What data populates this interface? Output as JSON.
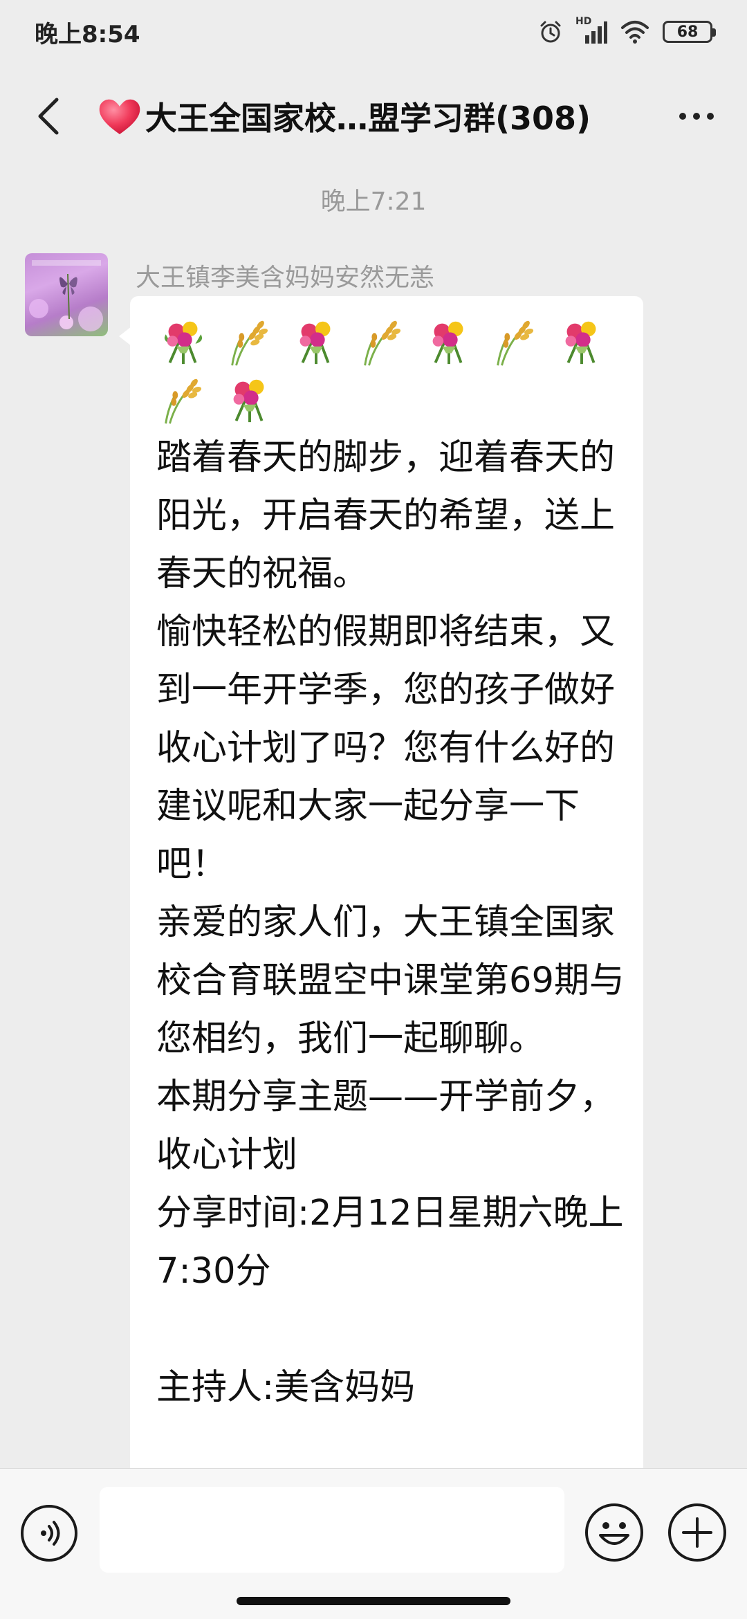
{
  "status_bar": {
    "time": "晚上8:54",
    "network_label": "HD",
    "battery": "68"
  },
  "header": {
    "title": "大王全国家校…盟学习群(308)",
    "heart_icon": "red-heart-emoji"
  },
  "chat": {
    "time_divider": "晚上7:21",
    "message": {
      "sender": "大王镇李美含妈妈安然无恙",
      "emoji_sequence": [
        "bouquet",
        "rice-ear",
        "bouquet",
        "rice-ear",
        "bouquet",
        "rice-ear",
        "bouquet",
        "rice-ear",
        "bouquet"
      ],
      "text": "踏着春天的脚步，迎着春天的阳光，开启春天的希望，送上春天的祝福。\n愉快轻松的假期即将结束，又到一年开学季，您的孩子做好收心计划了吗？您有什么好的建议呢和大家一起分享一下吧！\n亲爱的家人们，大王镇全国家校合育联盟空中课堂第69期与您相约，我们一起聊聊。\n本期分享主题——开学前夕，收心计划\n分享时间:2月12日星期六晚上7:30分\n\n主持人:美含妈妈"
    }
  },
  "input_bar": {
    "text_value": ""
  },
  "colors": {
    "background": "#ededed",
    "bubble": "#ffffff",
    "secondary_text": "#9a9a9a"
  }
}
